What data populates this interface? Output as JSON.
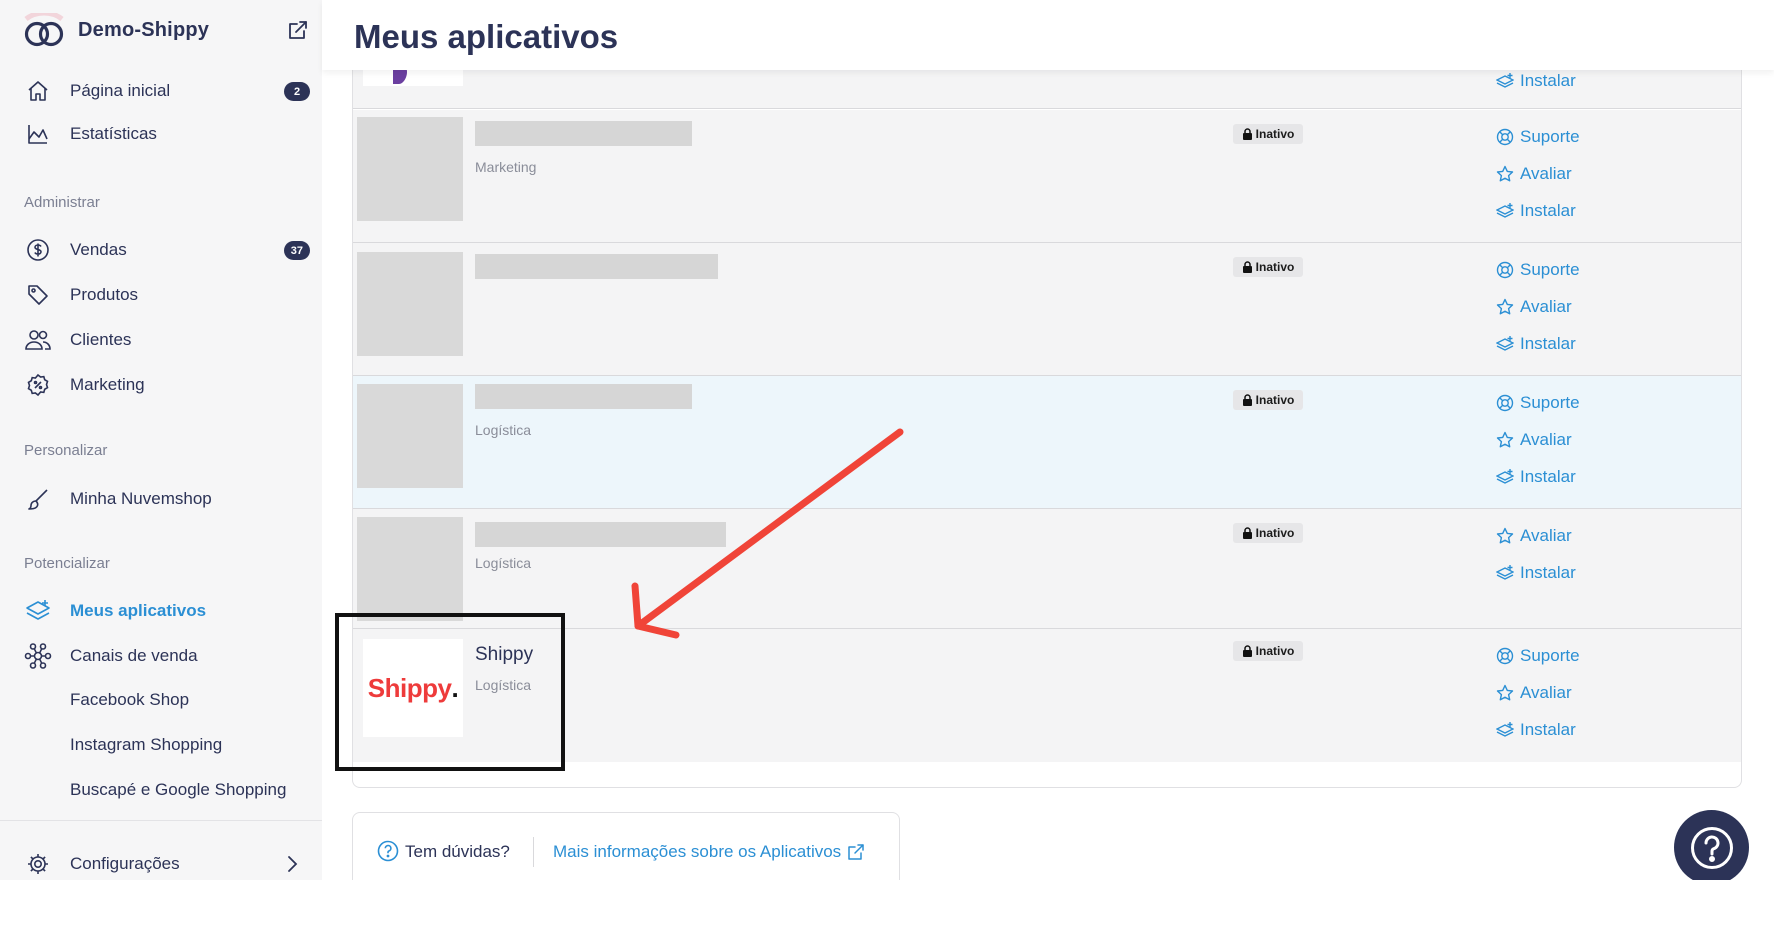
{
  "store": {
    "name": "Demo-Shippy"
  },
  "nav": {
    "home": {
      "label": "Página inicial",
      "badge": "2"
    },
    "stats": {
      "label": "Estatísticas"
    },
    "section_admin": "Administrar",
    "sales": {
      "label": "Vendas",
      "badge": "37"
    },
    "products": {
      "label": "Produtos"
    },
    "customers": {
      "label": "Clientes"
    },
    "marketing": {
      "label": "Marketing"
    },
    "section_customize": "Personalizar",
    "my_store": {
      "label": "Minha Nuvemshop"
    },
    "section_boost": "Potencializar",
    "my_apps": {
      "label": "Meus aplicativos"
    },
    "sales_channels": {
      "label": "Canais de venda"
    },
    "sub_channels": [
      "Facebook Shop",
      "Instagram Shopping",
      "Buscapé e Google Shopping"
    ],
    "settings": {
      "label": "Configurações"
    }
  },
  "page": {
    "title": "Meus aplicativos"
  },
  "apps": [
    {
      "name": "",
      "category": "",
      "status": "",
      "actions": [
        "Instalar"
      ]
    },
    {
      "name": "",
      "category": "Marketing",
      "status": "Inativo",
      "actions": [
        "Suporte",
        "Avaliar",
        "Instalar"
      ]
    },
    {
      "name": "",
      "category": "",
      "status": "Inativo",
      "actions": [
        "Suporte",
        "Avaliar",
        "Instalar"
      ]
    },
    {
      "name": "",
      "category": "Logística",
      "status": "Inativo",
      "actions": [
        "Suporte",
        "Avaliar",
        "Instalar"
      ]
    },
    {
      "name": "",
      "category": "Logística",
      "status": "Inativo",
      "actions": [
        "Avaliar",
        "Instalar"
      ]
    },
    {
      "name": "Shippy",
      "category": "Logística",
      "status": "Inativo",
      "actions": [
        "Suporte",
        "Avaliar",
        "Instalar"
      ],
      "logo_text": "Shippy",
      "logo_dot": "."
    }
  ],
  "help": {
    "question": "Tem dúvidas?",
    "link": "Mais informações sobre os Aplicativos"
  },
  "colors": {
    "primary": "#2c3357",
    "link": "#2b8fd4",
    "shippy_red": "#ee3b3b",
    "annotation_arrow": "#f04438",
    "row_bg": "#f4f4f5",
    "row_highlight": "#edf6fb"
  }
}
